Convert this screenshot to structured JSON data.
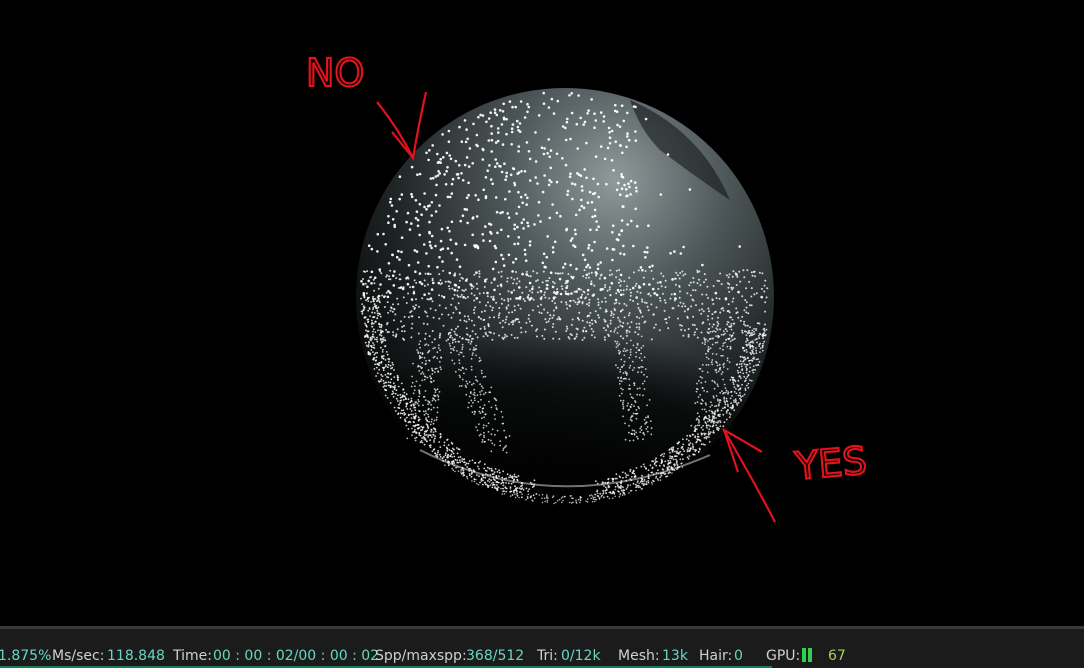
{
  "annotations": {
    "no_label": "NO",
    "yes_label": "YES",
    "color": "#e0121c"
  },
  "statusbar": {
    "progress": "1.875%",
    "ms_label": "Ms/sec:",
    "ms_value": "118.848",
    "time_label": "Time:",
    "time_value": "00 : 00 : 02/00 : 00 : 02",
    "spp_label": "Spp/maxspp:",
    "spp_value": "368/512",
    "tri_label": "Tri:",
    "tri_value": "0/12k",
    "mesh_label": "Mesh:",
    "mesh_value": "13k",
    "hair_label": "Hair:",
    "hair_value": "0",
    "gpu_label": "GPU:",
    "gpu_value": "67"
  },
  "colors": {
    "value_text": "#67d6c2",
    "gpu_value": "#a8cf62",
    "gpu_bar": "#2ed04e",
    "background": "#000000"
  }
}
